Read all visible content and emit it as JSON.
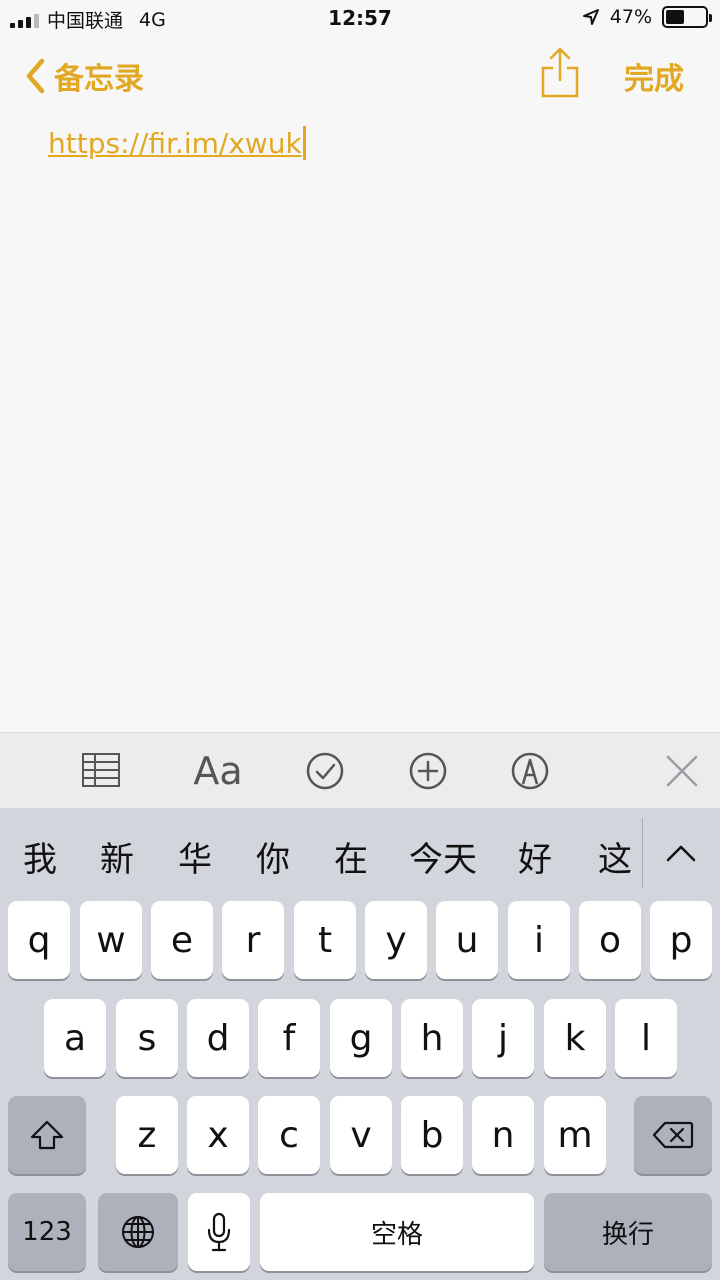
{
  "status_bar": {
    "carrier": "中国联通",
    "network": "4G",
    "time": "12:57",
    "battery": "47%",
    "battery_level": 0.47
  },
  "nav": {
    "back_label": "备忘录",
    "done_label": "完成",
    "accent_color": "#e3a823"
  },
  "note": {
    "text": "https://fir.im/xwuk"
  },
  "toolbar": {
    "items": [
      "table-icon",
      "format-text",
      "checklist-icon",
      "add-icon",
      "markup-icon",
      "close-icon"
    ],
    "format_label": "Aa"
  },
  "candidates": {
    "items": [
      "我",
      "新",
      "华",
      "你",
      "在",
      "今天",
      "好",
      "这"
    ]
  },
  "keyboard": {
    "row1": [
      "q",
      "w",
      "e",
      "r",
      "t",
      "y",
      "u",
      "i",
      "o",
      "p"
    ],
    "row2": [
      "a",
      "s",
      "d",
      "f",
      "g",
      "h",
      "j",
      "k",
      "l"
    ],
    "row3": [
      "z",
      "x",
      "c",
      "v",
      "b",
      "n",
      "m"
    ],
    "numbers_label": "123",
    "space_label": "空格",
    "return_label": "换行"
  }
}
